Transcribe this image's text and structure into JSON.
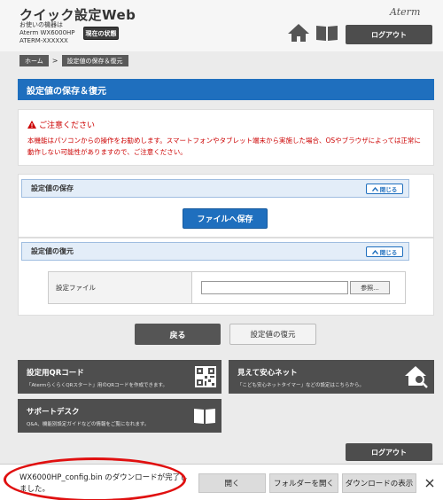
{
  "header": {
    "app_title": "クイック設定Web",
    "device_line1": "お使いの機器は",
    "device_line2": "Aterm WX6000HP",
    "device_line3": "ATERM-XXXXXX",
    "status_button": "現在の状態",
    "brand": "Aterm",
    "logout_button": "ログアウト"
  },
  "breadcrumb": {
    "home": "ホーム",
    "separator": ">",
    "current": "設定値の保存＆復元"
  },
  "page": {
    "heading": "設定値の保存＆復元"
  },
  "notice": {
    "title": "ご注意ください",
    "text": "本機能はパソコンからの操作をお勧めします。スマートフォンやタブレット端末から実施した場合、OSやブラウザによっては正常に動作しない可能性がありますので、ご注意ください。"
  },
  "save_panel": {
    "title": "設定値の保存",
    "close_label": "閉じる",
    "save_button": "ファイルへ保存"
  },
  "restore_panel": {
    "title": "設定値の復元",
    "close_label": "閉じる",
    "file_label": "設定ファイル",
    "file_value": "",
    "browse_button": "参照..."
  },
  "actions": {
    "back_button": "戻る",
    "restore_button": "設定値の復元"
  },
  "tiles": {
    "qr": {
      "title": "設定用QRコード",
      "desc": "「AtermらくらくQRスタート」用のQRコードを作成できます。"
    },
    "safe_net": {
      "title": "見えて安心ネット",
      "desc": "「こども安心ネットタイマー」などの設定はこちらから。"
    },
    "support": {
      "title": "サポートデスク",
      "desc": "Q&A、機能別設定ガイドなどの情報をご覧になれます。"
    }
  },
  "footer": {
    "logout_button": "ログアウト"
  },
  "download_bar": {
    "message": "WX6000HP_config.bin のダウンロードが完了しました。",
    "open_button": "開く",
    "open_folder_button": "フォルダーを開く",
    "view_downloads_button": "ダウンロードの表示"
  },
  "colors": {
    "primary": "#1f6fbe",
    "warning": "#cc0000",
    "dark": "#4e4e4e",
    "highlight": "#e01010"
  }
}
